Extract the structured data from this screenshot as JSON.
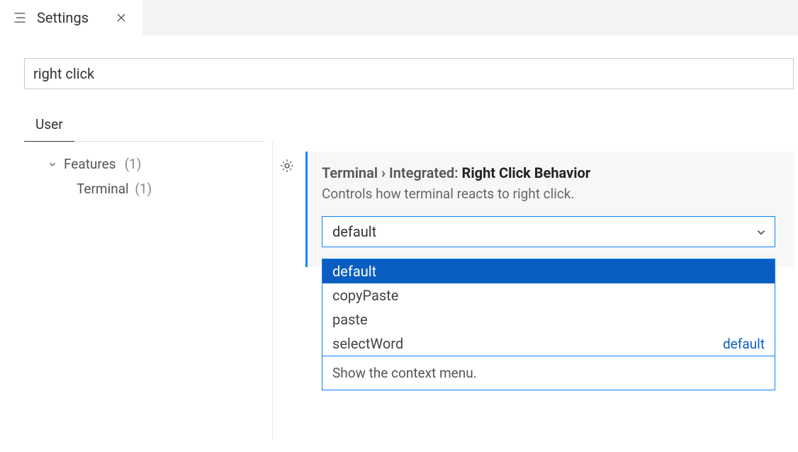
{
  "tab": {
    "title": "Settings"
  },
  "search": {
    "value": "right click"
  },
  "scope": {
    "user": "User"
  },
  "tree": {
    "features_label": "Features",
    "features_count": "(1)",
    "terminal_label": "Terminal",
    "terminal_count": "(1)"
  },
  "setting": {
    "breadcrumb": "Terminal › Integrated: ",
    "name": "Right Click Behavior",
    "description": "Controls how terminal reacts to right click.",
    "selected": "default"
  },
  "dropdown": {
    "options": {
      "0": "default",
      "1": "copyPaste",
      "2": "paste",
      "3": "selectWord"
    },
    "default_badge": "default",
    "info": "Show the context menu."
  }
}
